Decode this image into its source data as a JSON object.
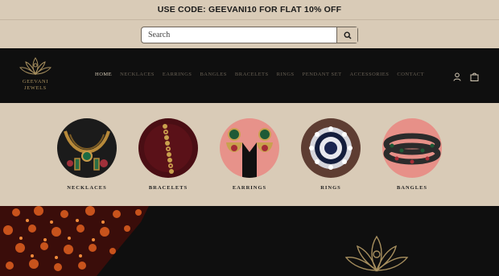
{
  "promo": {
    "text": "USE CODE: GEEVANI10 FOR FLAT 10% OFF"
  },
  "search": {
    "placeholder": "Search",
    "icon": "search-icon"
  },
  "logo": {
    "line1": "GEEVANI",
    "line2": "JEWELS"
  },
  "nav": {
    "items": [
      {
        "label": "HOME",
        "active": true
      },
      {
        "label": "NECKLACES"
      },
      {
        "label": "EARRINGS"
      },
      {
        "label": "BANGLES"
      },
      {
        "label": "BRACELETS"
      },
      {
        "label": "RINGS"
      },
      {
        "label": "PENDANT SET"
      },
      {
        "label": "ACCESSORIES"
      },
      {
        "label": "CONTACT"
      }
    ]
  },
  "header_icons": {
    "account": "account-icon",
    "cart": "shopping-bag-icon"
  },
  "categories": [
    {
      "label": "NECKLACES"
    },
    {
      "label": "BRACELETS"
    },
    {
      "label": "EARRINGS"
    },
    {
      "label": "RINGS"
    },
    {
      "label": "BANGLES"
    }
  ],
  "colors": {
    "background": "#d9cbb7",
    "header": "#0f0f0f",
    "gold": "#a8905f",
    "accent_orange": "#c8531c"
  }
}
